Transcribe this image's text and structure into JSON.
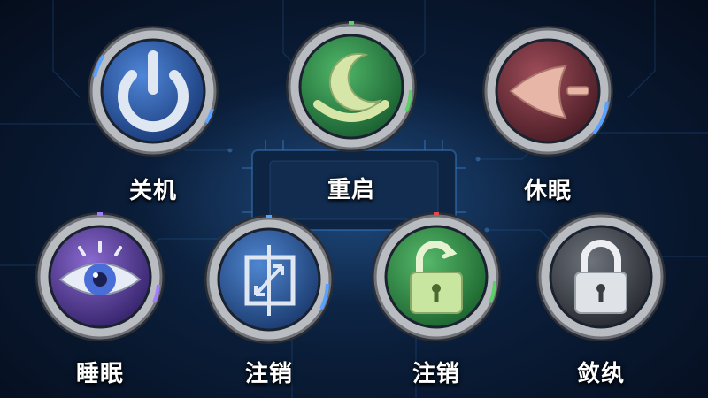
{
  "buttons": [
    {
      "label": "关机",
      "icon": "power-icon",
      "accent": "#2c5aa8"
    },
    {
      "label": "重启",
      "icon": "crescent-moon-icon",
      "accent": "#2f8a45"
    },
    {
      "label": "休眠",
      "icon": "sleep-arrow-icon",
      "accent": "#7a3340"
    },
    {
      "label": "睡眠",
      "icon": "eye-icon",
      "accent": "#5a3f95"
    },
    {
      "label": "注销",
      "icon": "switch-user-icon",
      "accent": "#2a5b9c"
    },
    {
      "label": "注销",
      "icon": "unlock-icon",
      "accent": "#2e8a3c"
    },
    {
      "label": "敛纨",
      "icon": "padlock-icon",
      "accent": "#4a4f57"
    }
  ]
}
